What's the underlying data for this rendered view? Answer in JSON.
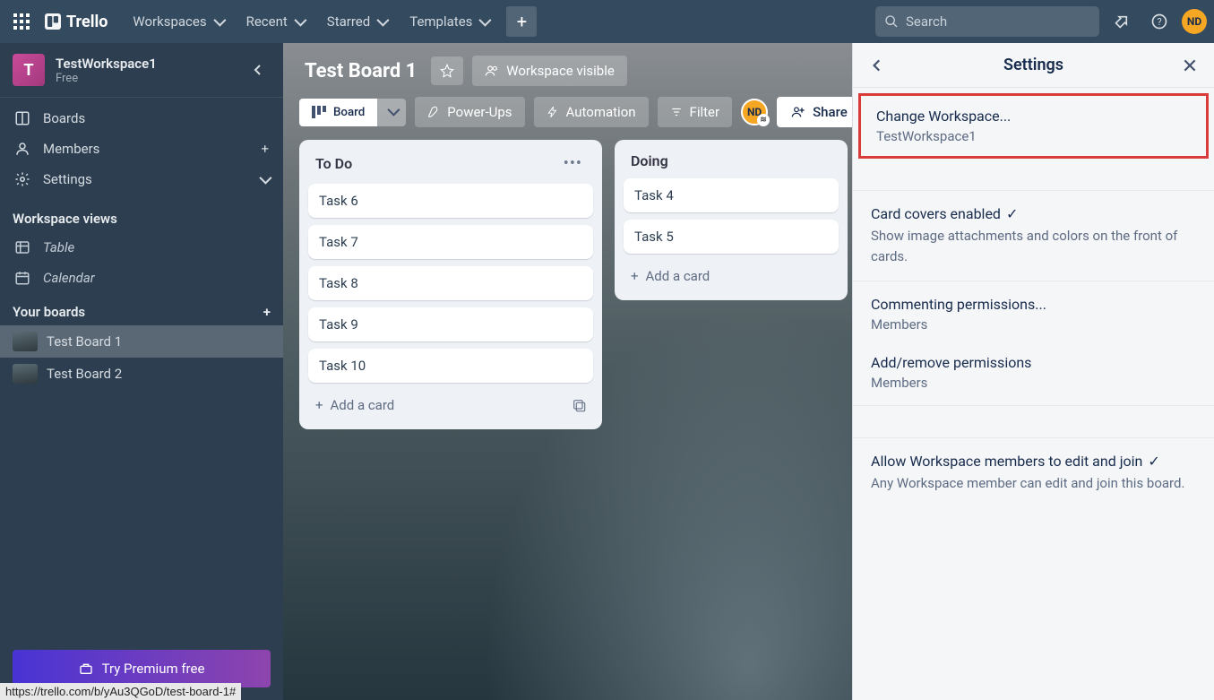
{
  "topnav": {
    "logo": "Trello",
    "menus": [
      "Workspaces",
      "Recent",
      "Starred",
      "Templates"
    ],
    "search_placeholder": "Search",
    "avatar": "ND"
  },
  "sidebar": {
    "workspace_initial": "T",
    "workspace_name": "TestWorkspace1",
    "workspace_plan": "Free",
    "nav": [
      {
        "label": "Boards",
        "icon": "boards"
      },
      {
        "label": "Members",
        "icon": "members",
        "trail": "plus"
      },
      {
        "label": "Settings",
        "icon": "settings",
        "trail": "chev"
      }
    ],
    "views_heading": "Workspace views",
    "views": [
      {
        "label": "Table",
        "icon": "table"
      },
      {
        "label": "Calendar",
        "icon": "calendar"
      }
    ],
    "boards_heading": "Your boards",
    "boards": [
      {
        "label": "Test Board 1",
        "active": true
      },
      {
        "label": "Test Board 2",
        "active": false
      }
    ],
    "premium_label": "Try Premium free"
  },
  "board": {
    "title": "Test Board 1",
    "visibility": "Workspace visible",
    "view_label": "Board",
    "powerups": "Power-Ups",
    "automation": "Automation",
    "filter": "Filter",
    "share": "Share",
    "member": "ND",
    "lists": [
      {
        "title": "To Do",
        "cards": [
          "Task 6",
          "Task 7",
          "Task 8",
          "Task 9",
          "Task 10"
        ],
        "add_label": "Add a card"
      },
      {
        "title": "Doing",
        "cards": [
          "Task 4",
          "Task 5"
        ],
        "add_label": "Add a card"
      }
    ]
  },
  "settings": {
    "title": "Settings",
    "change_ws_label": "Change Workspace...",
    "change_ws_value": "TestWorkspace1",
    "covers_title": "Card covers enabled",
    "covers_desc": "Show image attachments and colors on the front of cards.",
    "commenting_title": "Commenting permissions...",
    "commenting_value": "Members",
    "addremove_title": "Add/remove permissions",
    "addremove_value": "Members",
    "allow_title": "Allow Workspace members to edit and join",
    "allow_desc": "Any Workspace member can edit and join this board."
  },
  "statusbar": "https://trello.com/b/yAu3QGoD/test-board-1#"
}
